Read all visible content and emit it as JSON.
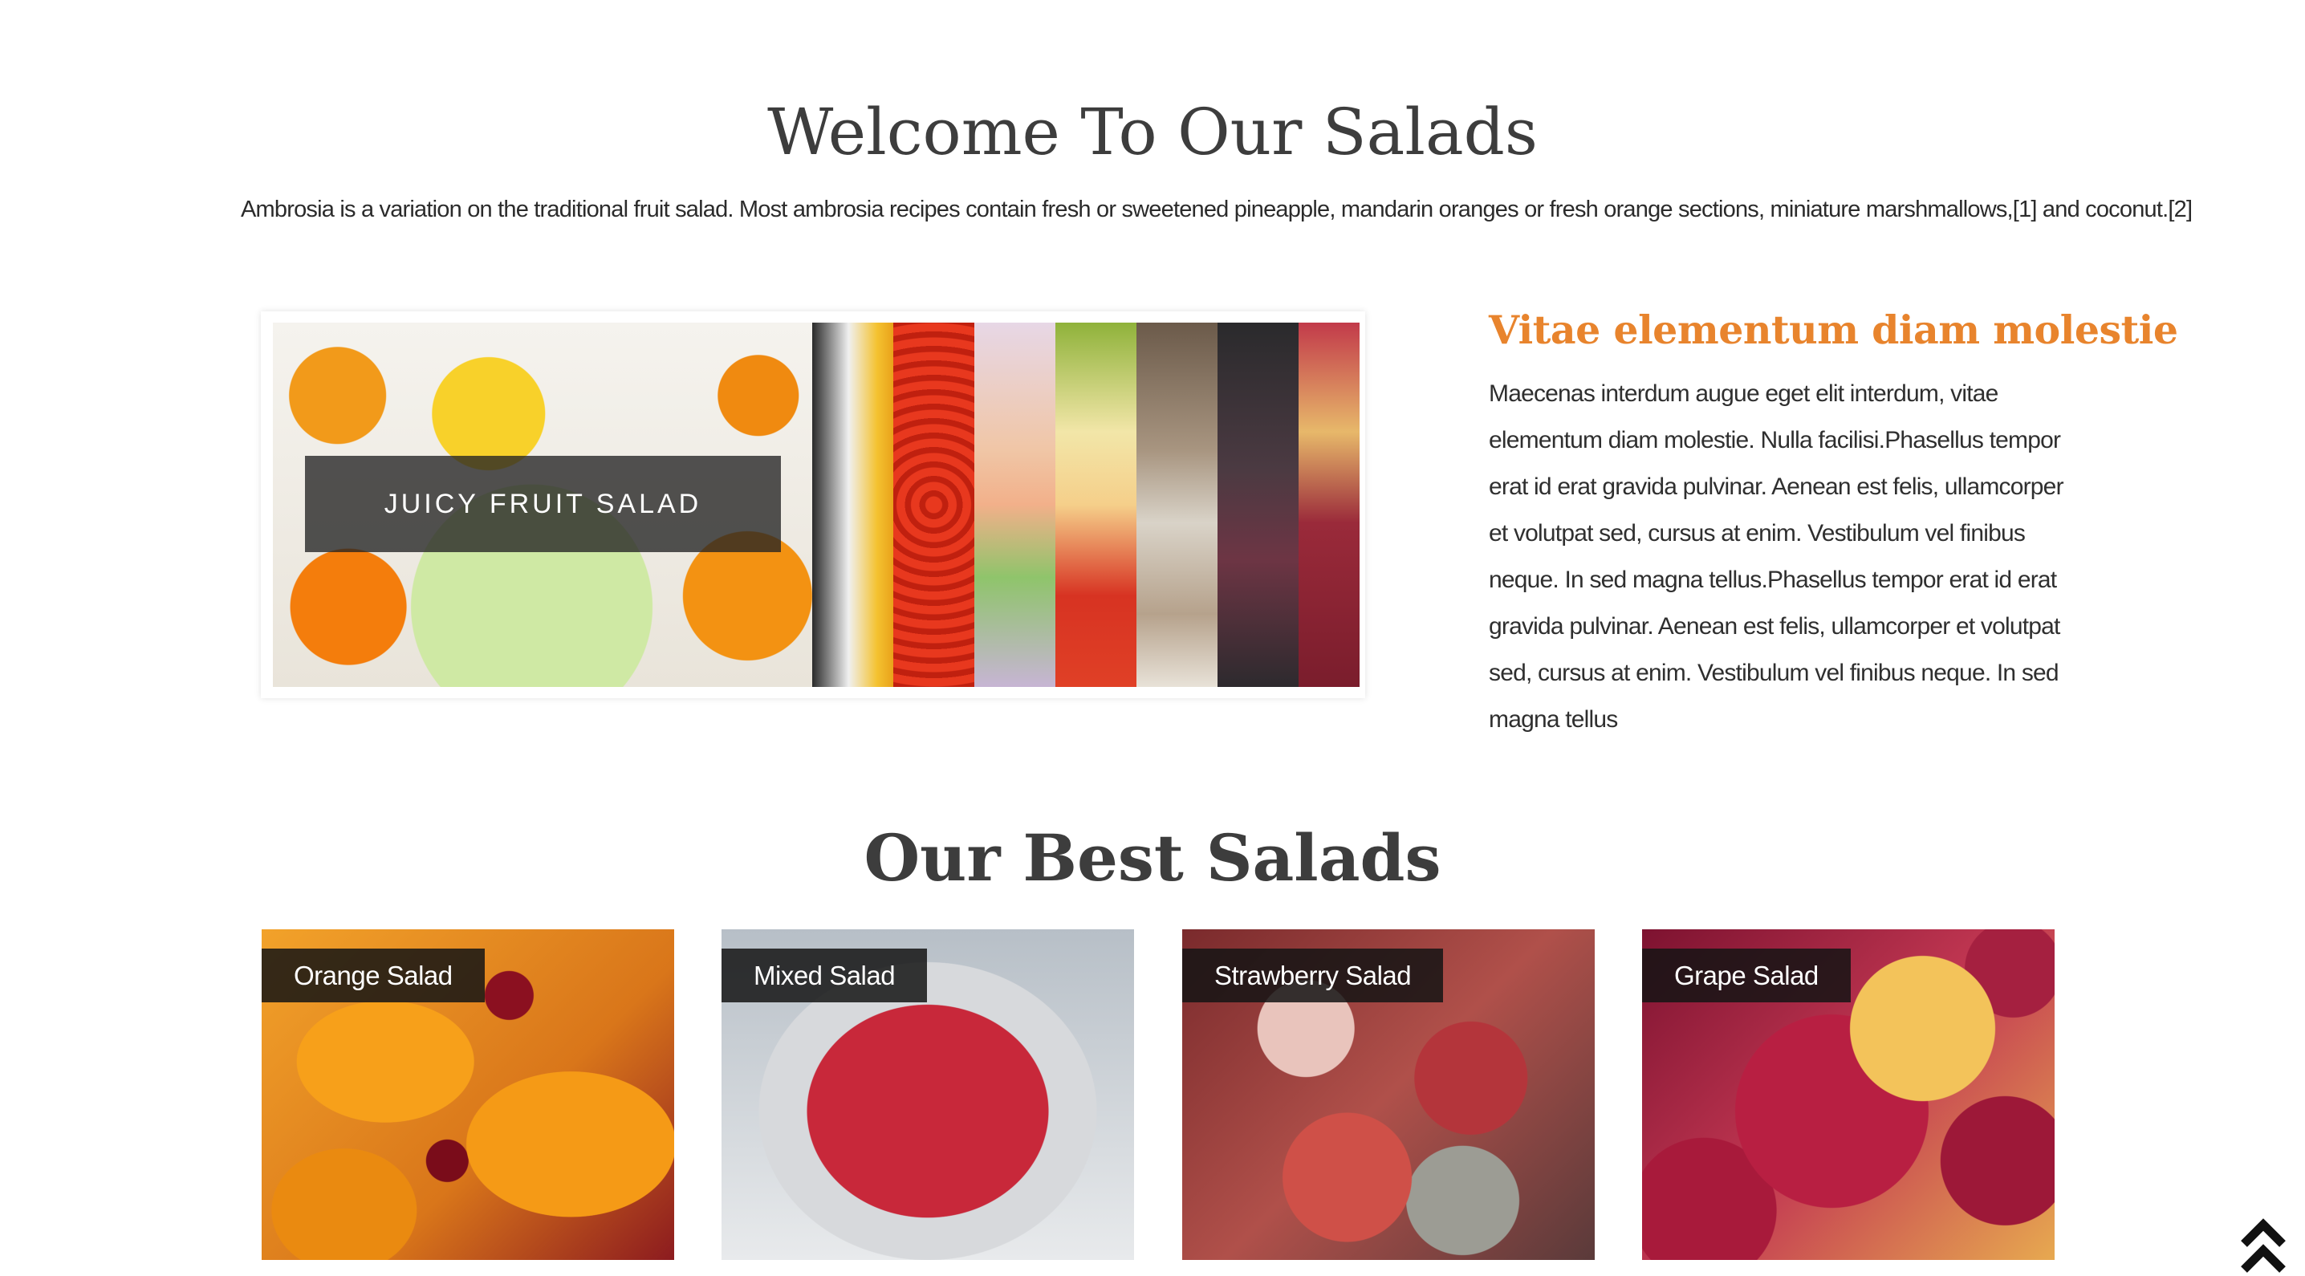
{
  "welcome": {
    "title": "Welcome To Our Salads",
    "text": "Ambrosia is a variation on the traditional fruit salad. Most ambrosia recipes contain fresh or sweetened pineapple, mandarin oranges or fresh orange sections, miniature marshmallows,[1] and coconut.[2]"
  },
  "slider": {
    "caption": "JUICY FRUIT SALAD"
  },
  "feature": {
    "title": "Vitae elementum diam molestie",
    "body": "Maecenas interdum augue eget elit interdum, vitae elementum diam molestie. Nulla facilisi.Phasellus tempor erat id erat gravida pulvinar. Aenean est felis, ullamcorper et volutpat sed, cursus at enim. Vestibulum vel finibus neque. In sed magna tellus.Phasellus tempor erat id erat gravida pulvinar. Aenean est felis, ullamcorper et volutpat sed, cursus at enim. Vestibulum vel finibus neque. In sed magna tellus"
  },
  "best": {
    "title": "Our Best Salads",
    "cards": [
      {
        "label": "Orange Salad"
      },
      {
        "label": "Mixed Salad"
      },
      {
        "label": "Strawberry Salad"
      },
      {
        "label": "Grape Salad"
      }
    ]
  },
  "icons": {
    "back_to_top": "double-chevron-up-icon"
  }
}
